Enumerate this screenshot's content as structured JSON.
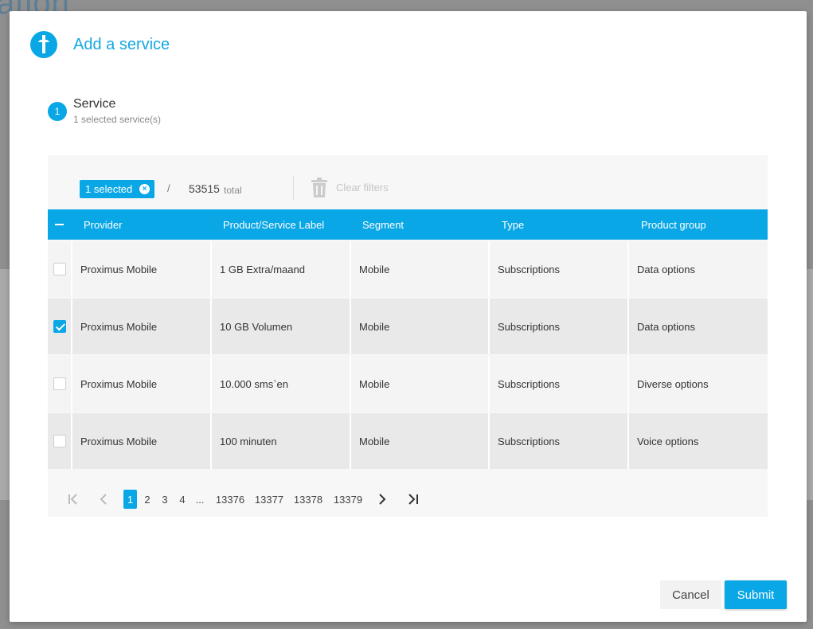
{
  "background": {
    "title_fragment": "ation"
  },
  "modal": {
    "title": "Add a service",
    "step": {
      "number": "1",
      "title": "Service",
      "subtitle": "1 selected service(s)"
    }
  },
  "toolbar": {
    "selected_label": "1 selected",
    "chip_close": "×",
    "slash": "/",
    "total_count": "53515",
    "total_label": "total",
    "clear_filters": "Clear filters"
  },
  "table": {
    "columns": [
      "Provider",
      "Product/Service Label",
      "Segment",
      "Type",
      "Product group"
    ],
    "rows": [
      {
        "checked": false,
        "provider": "Proximus Mobile",
        "label": "1 GB Extra/maand",
        "segment": "Mobile",
        "type": "Subscriptions",
        "group": "Data options"
      },
      {
        "checked": true,
        "provider": "Proximus Mobile",
        "label": "10 GB Volumen",
        "segment": "Mobile",
        "type": "Subscriptions",
        "group": "Data options"
      },
      {
        "checked": false,
        "provider": "Proximus Mobile",
        "label": "10.000 sms`en",
        "segment": "Mobile",
        "type": "Subscriptions",
        "group": "Diverse options"
      },
      {
        "checked": false,
        "provider": "Proximus Mobile",
        "label": "100 minuten",
        "segment": "Mobile",
        "type": "Subscriptions",
        "group": "Voice options"
      }
    ]
  },
  "pagination": {
    "first": "|<",
    "prev": "<",
    "pages": [
      "1",
      "2",
      "3",
      "4",
      "...",
      "13376",
      "13377",
      "13378",
      "13379"
    ],
    "active": "1",
    "next": ">",
    "last": ">|"
  },
  "actions": {
    "cancel": "Cancel",
    "submit": "Submit"
  },
  "colors": {
    "accent": "#0aa7e6",
    "row_light": "#f4f4f4",
    "row_dark": "#e9e9e9"
  }
}
